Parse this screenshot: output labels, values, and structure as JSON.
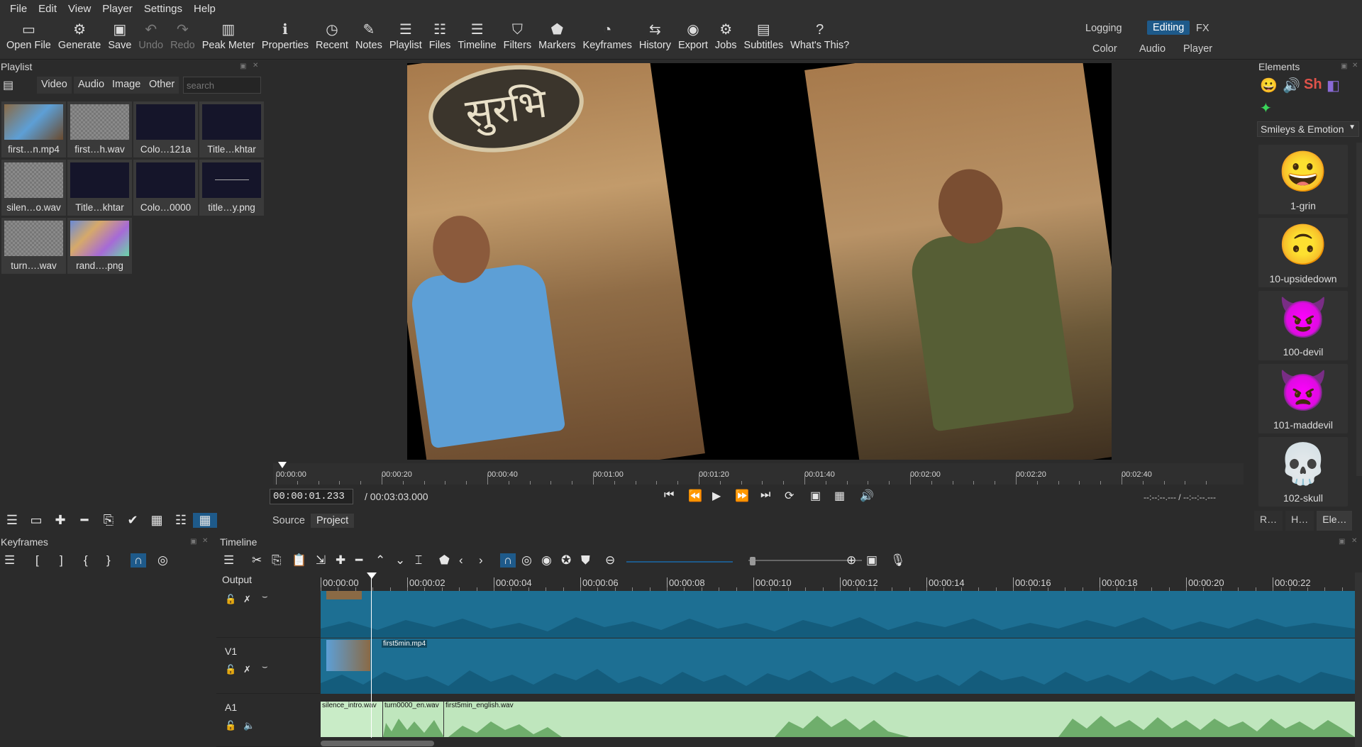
{
  "menu": [
    "File",
    "Edit",
    "View",
    "Player",
    "Settings",
    "Help"
  ],
  "toolbar": [
    {
      "label": "Open File",
      "icon": "folder-open-icon",
      "glyph": "▭",
      "enabled": true
    },
    {
      "label": "Generate",
      "icon": "generate-icon",
      "glyph": "⚙",
      "enabled": true
    },
    {
      "label": "Save",
      "icon": "save-icon",
      "glyph": "▣",
      "enabled": true
    },
    {
      "label": "Undo",
      "icon": "undo-icon",
      "glyph": "↶",
      "enabled": false
    },
    {
      "label": "Redo",
      "icon": "redo-icon",
      "glyph": "↷",
      "enabled": false
    },
    {
      "label": "Peak Meter",
      "icon": "peak-meter-icon",
      "glyph": "▥",
      "enabled": true
    },
    {
      "label": "Properties",
      "icon": "info-icon",
      "glyph": "ℹ",
      "enabled": true
    },
    {
      "label": "Recent",
      "icon": "clock-icon",
      "glyph": "◷",
      "enabled": true
    },
    {
      "label": "Notes",
      "icon": "notes-icon",
      "glyph": "✎",
      "enabled": true
    },
    {
      "label": "Playlist",
      "icon": "playlist-icon",
      "glyph": "☰",
      "enabled": true
    },
    {
      "label": "Files",
      "icon": "files-icon",
      "glyph": "☷",
      "enabled": true
    },
    {
      "label": "Timeline",
      "icon": "timeline-icon",
      "glyph": "☰",
      "enabled": true
    },
    {
      "label": "Filters",
      "icon": "filter-icon",
      "glyph": "⛉",
      "enabled": true
    },
    {
      "label": "Markers",
      "icon": "marker-icon",
      "glyph": "⬟",
      "enabled": true
    },
    {
      "label": "Keyframes",
      "icon": "stopwatch-icon",
      "glyph": "◔",
      "enabled": true
    },
    {
      "label": "History",
      "icon": "history-icon",
      "glyph": "⇆",
      "enabled": true
    },
    {
      "label": "Export",
      "icon": "export-icon",
      "glyph": "◉",
      "enabled": true
    },
    {
      "label": "Jobs",
      "icon": "gear-icon",
      "glyph": "⚙",
      "enabled": true
    },
    {
      "label": "Subtitles",
      "icon": "subtitles-icon",
      "glyph": "▤",
      "enabled": true
    },
    {
      "label": "What's This?",
      "icon": "question-icon",
      "glyph": "?",
      "enabled": true
    }
  ],
  "workspaces": {
    "logging": "Logging",
    "editing": "Editing",
    "fx": "FX",
    "color": "Color",
    "audio": "Audio",
    "player": "Player",
    "active": "Editing"
  },
  "playlist": {
    "title": "Playlist",
    "tabs": [
      "Video",
      "Audio",
      "Image",
      "Other"
    ],
    "search_placeholder": "search",
    "items": [
      {
        "name": "first…n.mp4",
        "kind": "video"
      },
      {
        "name": "first…h.wav",
        "kind": "audio"
      },
      {
        "name": "Colo…121a",
        "kind": "color"
      },
      {
        "name": "Title…khtar",
        "kind": "title"
      },
      {
        "name": "silen…o.wav",
        "kind": "audio"
      },
      {
        "name": "Title…khtar",
        "kind": "title"
      },
      {
        "name": "Colo…0000",
        "kind": "color"
      },
      {
        "name": "title…y.png",
        "kind": "image"
      },
      {
        "name": "turn….wav",
        "kind": "audio"
      },
      {
        "name": "rand….png",
        "kind": "image"
      }
    ]
  },
  "player": {
    "ruler_labels": [
      "00:00:00",
      "00:00:20",
      "00:00:40",
      "00:01:00",
      "00:01:20",
      "00:01:40",
      "00:02:00",
      "00:02:20",
      "00:02:40"
    ],
    "position": "00:00:01.233",
    "duration": "/ 00:03:03.000",
    "in_out": "--:--:--.--- / --:--:--.---",
    "source_tab": "Source",
    "project_tab": "Project",
    "overlay_text": "सुरभि"
  },
  "elements": {
    "title": "Elements",
    "category": "Smileys & Emotion",
    "items": [
      {
        "emoji": "😀",
        "name": "1-grin"
      },
      {
        "emoji": "🙃",
        "name": "10-upsidedown"
      },
      {
        "emoji": "😈",
        "name": "100-devil"
      },
      {
        "emoji": "👿",
        "name": "101-maddevil"
      },
      {
        "emoji": "💀",
        "name": "102-skull"
      }
    ],
    "bottom_tabs": [
      "R…",
      "H…",
      "Ele…"
    ]
  },
  "keyframes": {
    "title": "Keyframes"
  },
  "timeline": {
    "title": "Timeline",
    "output_label": "Output",
    "ruler_labels": [
      "00:00:00",
      "00:00:02",
      "00:00:04",
      "00:00:06",
      "00:00:08",
      "00:00:10",
      "00:00:12",
      "00:00:14",
      "00:00:16",
      "00:00:18",
      "00:00:20",
      "00:00:22"
    ],
    "tracks": [
      {
        "name": "",
        "clips": []
      },
      {
        "name": "V1",
        "clips": [
          {
            "label": "first5min.mp4"
          }
        ]
      },
      {
        "name": "A1",
        "clips": [
          {
            "label": "silence_intro.wav"
          },
          {
            "label": "turn0000_en.wav"
          },
          {
            "label": "first5min_english.wav"
          }
        ]
      }
    ]
  },
  "colors": {
    "accent": "#1e5a8a",
    "track": "#1d6f93",
    "audio_clip": "#bfe6bd"
  }
}
